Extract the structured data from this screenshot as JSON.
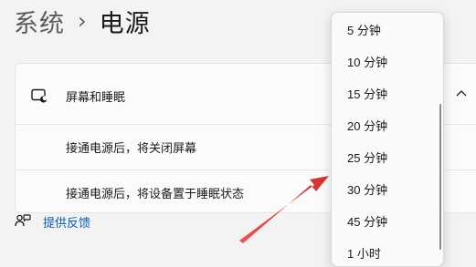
{
  "breadcrumb": {
    "parent": "系统",
    "separator": "›",
    "current": "电源"
  },
  "card": {
    "header_label": "屏幕和睡眠",
    "rows": [
      {
        "label": "接通电源后，将关闭屏幕"
      },
      {
        "label": "接通电源后，将设备置于睡眠状态"
      }
    ]
  },
  "feedback": {
    "label": "提供反馈"
  },
  "dropdown": {
    "options": [
      "5 分钟",
      "10 分钟",
      "15 分钟",
      "20 分钟",
      "25 分钟",
      "30 分钟",
      "45 分钟",
      "1 小时"
    ]
  },
  "colors": {
    "annotation_arrow": "#e53935",
    "link": "#0a5bb5"
  },
  "icons": {
    "header": "monitor-sleep-icon",
    "expand": "chevron-up-icon",
    "feedback": "feedback-icon",
    "annotation": "arrow-icon"
  }
}
